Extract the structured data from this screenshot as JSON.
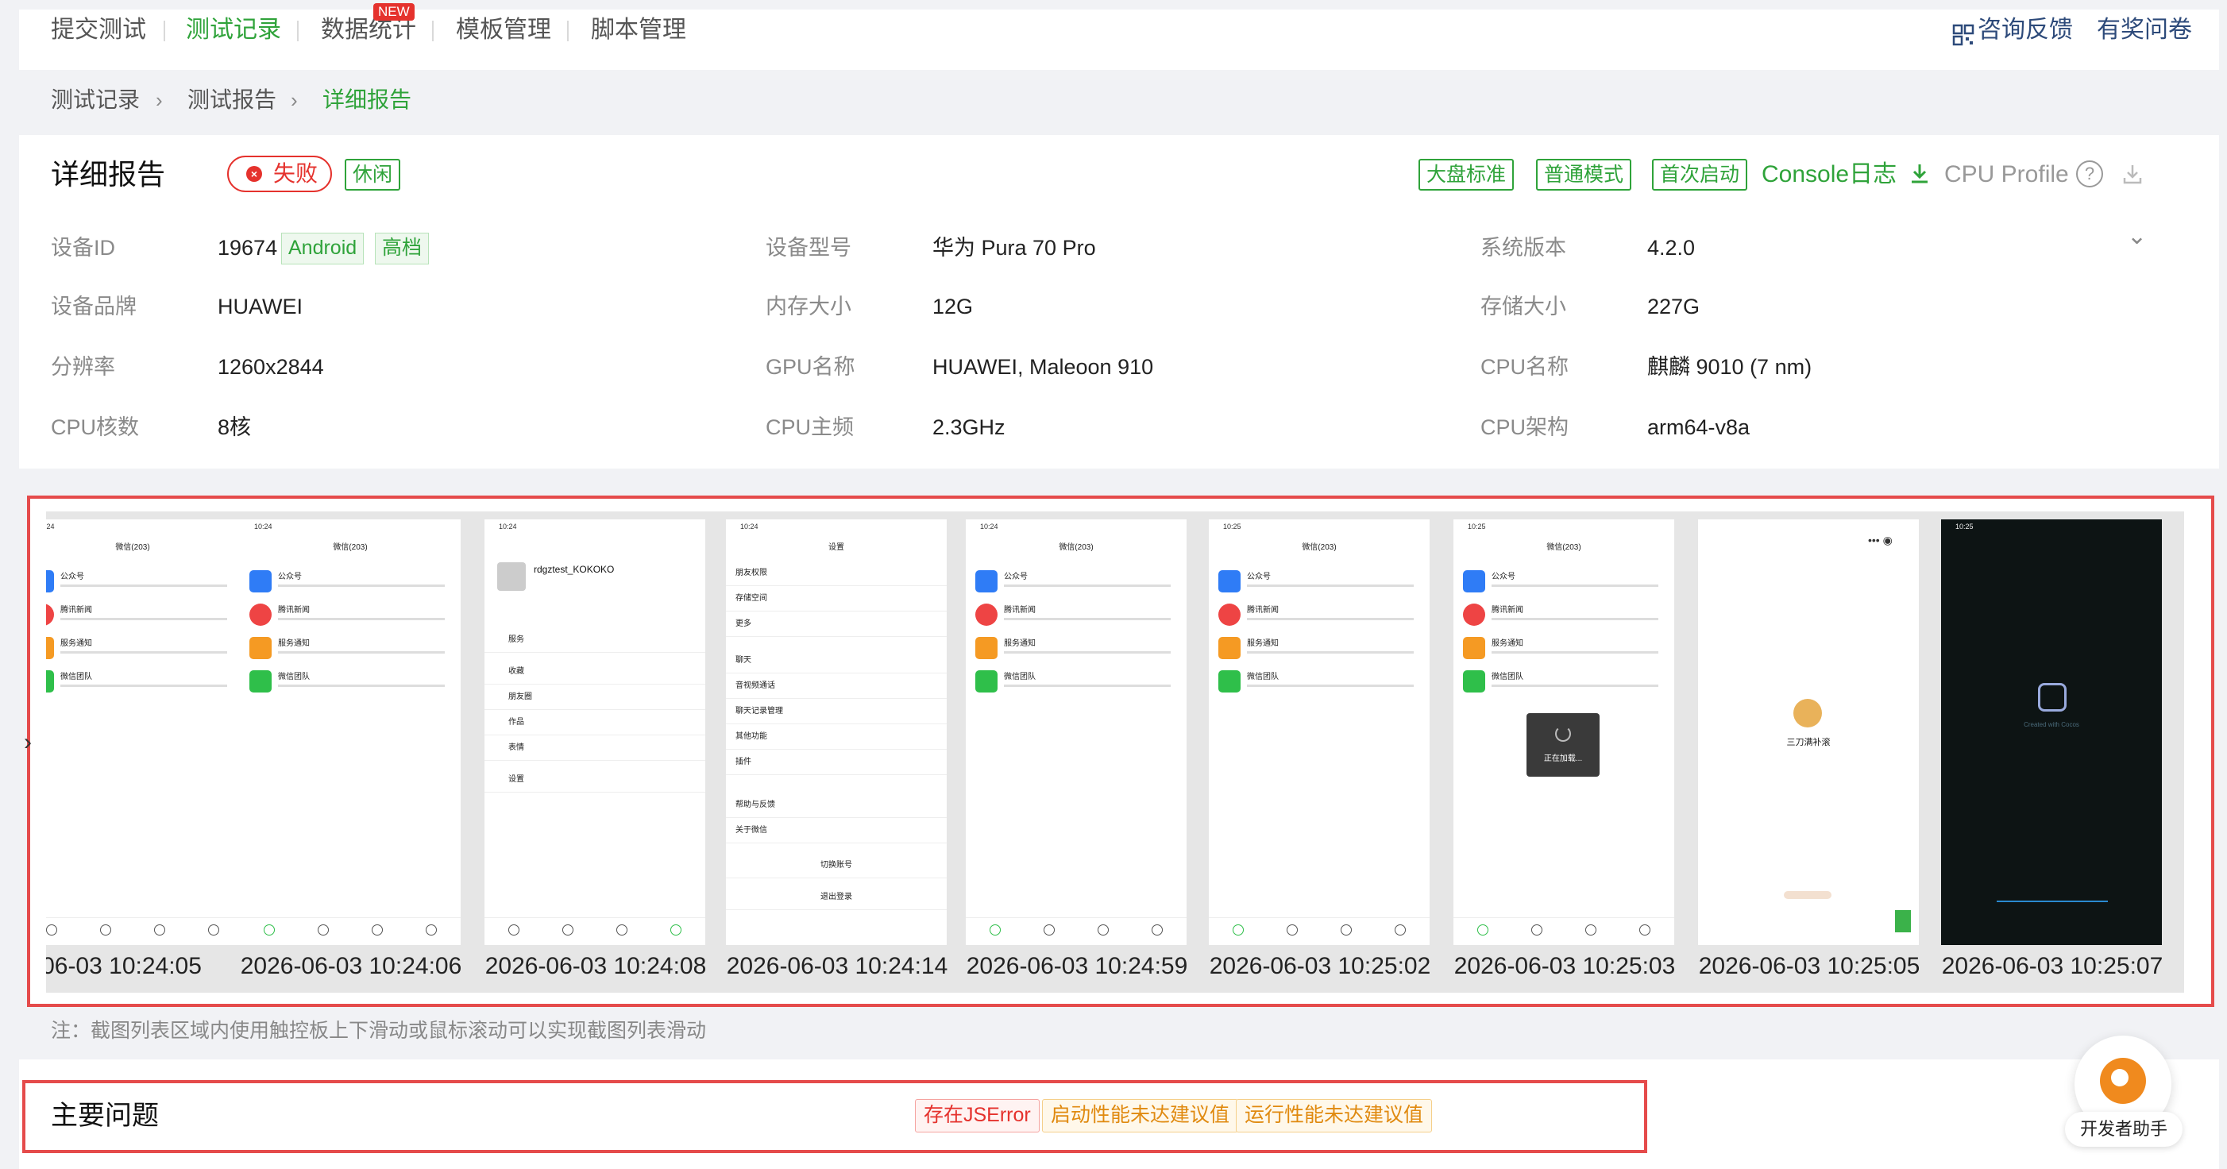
{
  "nav": {
    "items": [
      "提交测试",
      "测试记录",
      "数据统计",
      "模板管理",
      "脚本管理"
    ],
    "new_badge": "NEW",
    "feedback": "咨询反馈",
    "survey": "有奖问卷"
  },
  "breadcrumb": [
    "测试记录",
    "测试报告",
    "详细报告"
  ],
  "report": {
    "title": "详细报告",
    "status": "失败",
    "category_tag": "休闲",
    "mode_tags": [
      "大盘标准",
      "普通模式",
      "首次启动"
    ],
    "console_log": "Console日志",
    "cpu_profile": "CPU Profile"
  },
  "device": {
    "id_label": "设备ID",
    "id_value": "19674",
    "id_tags": [
      "Android",
      "高档"
    ],
    "model_label": "设备型号",
    "model_value": "华为 Pura 70 Pro",
    "os_label": "系统版本",
    "os_value": "4.2.0",
    "brand_label": "设备品牌",
    "brand_value": "HUAWEI",
    "ram_label": "内存大小",
    "ram_value": "12G",
    "storage_label": "存储大小",
    "storage_value": "227G",
    "res_label": "分辨率",
    "res_value": "1260x2844",
    "gpu_label": "GPU名称",
    "gpu_value": "HUAWEI, Maleoon 910",
    "cpu_name_label": "CPU名称",
    "cpu_name_value": "麒麟 9010 (7 nm)",
    "cores_label": "CPU核数",
    "cores_value": "8核",
    "freq_label": "CPU主频",
    "freq_value": "2.3GHz",
    "arch_label": "CPU架构",
    "arch_value": "arm64-v8a"
  },
  "screenshots": {
    "timestamps": [
      "-06-03 10:24:05",
      "2026-06-03 10:24:06",
      "2026-06-03 10:24:08",
      "2026-06-03 10:24:14",
      "2026-06-03 10:24:59",
      "2026-06-03 10:25:02",
      "2026-06-03 10:25:03",
      "2026-06-03 10:25:05",
      "2026-06-03 10:25:07"
    ],
    "wechat_title": "微信(203)",
    "chat_rows": [
      "公众号",
      "腾讯新闻",
      "服务通知",
      "微信团队"
    ],
    "profile_name": "rdgztest_KOKOKO",
    "profile_items": [
      "服务",
      "收藏",
      "朋友圈",
      "作品",
      "表情",
      "设置"
    ],
    "settings_title": "设置",
    "settings_items": [
      "朋友权限",
      "存储空间",
      "更多",
      "聊天",
      "音视频通话",
      "聊天记录管理",
      "其他功能",
      "插件",
      "帮助与反馈",
      "关于微信",
      "切换账号",
      "退出登录"
    ],
    "loading_text": "正在加载...",
    "game_name": "三刀满补滚",
    "cocos_text": "Created with Cocos",
    "note": "注：截图列表区域内使用触控板上下滑动或鼠标滚动可以实现截图列表滑动"
  },
  "issues": {
    "title": "主要问题",
    "tags": [
      "存在JSError",
      "启动性能未达建议值",
      "运行性能未达建议值"
    ]
  },
  "assistant": {
    "label": "开发者助手"
  },
  "colors": {
    "accent": "#2fa33a",
    "error": "#e5322d",
    "warning": "#e08a10",
    "highlight_border": "#e54b4b"
  }
}
